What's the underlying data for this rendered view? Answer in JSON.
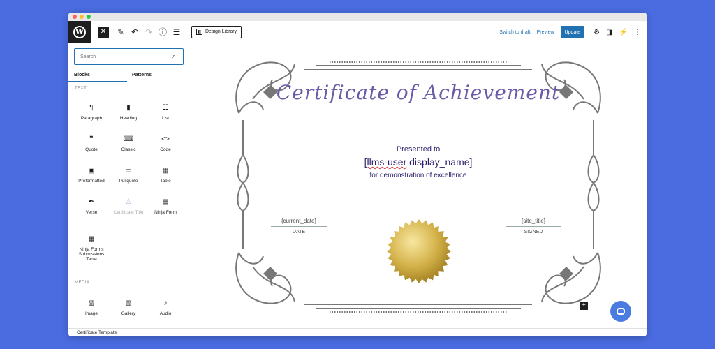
{
  "toolbar": {
    "close_glyph": "✕",
    "design_library_label": "Design Library",
    "switch_to_draft_label": "Switch to draft",
    "preview_label": "Preview",
    "update_label": "Update"
  },
  "sidebar": {
    "search_placeholder": "Search",
    "tabs": [
      {
        "label": "Blocks"
      },
      {
        "label": "Patterns"
      }
    ],
    "sections": {
      "text": {
        "label": "TEXT",
        "items": [
          {
            "label": "Paragraph",
            "icon": "paragraph-icon"
          },
          {
            "label": "Heading",
            "icon": "heading-icon"
          },
          {
            "label": "List",
            "icon": "list-icon"
          },
          {
            "label": "Quote",
            "icon": "quote-icon"
          },
          {
            "label": "Classic",
            "icon": "keyboard-icon"
          },
          {
            "label": "Code",
            "icon": "code-icon"
          },
          {
            "label": "Preformatted",
            "icon": "preformatted-icon"
          },
          {
            "label": "Pullquote",
            "icon": "pullquote-icon"
          },
          {
            "label": "Table",
            "icon": "table-icon"
          },
          {
            "label": "Verse",
            "icon": "verse-icon"
          },
          {
            "label": "Certificate Title",
            "icon": "certificate-icon"
          },
          {
            "label": "Ninja Form",
            "icon": "form-icon"
          },
          {
            "label": "Ninja Forms Submissions Table",
            "icon": "submissions-table-icon"
          }
        ]
      },
      "media": {
        "label": "MEDIA",
        "items": [
          {
            "label": "Image",
            "icon": "image-icon"
          },
          {
            "label": "Gallery",
            "icon": "gallery-icon"
          },
          {
            "label": "Audio",
            "icon": "audio-icon"
          }
        ]
      }
    }
  },
  "certificate": {
    "title": "Certificate of Achievement",
    "presented_to": "Presented to",
    "user_name_prefix": "[llms-user",
    "user_name_suffix": " display_name]",
    "excellence": "for demonstration of excellence",
    "date_value": "{current_date}",
    "date_label": "DATE",
    "signed_value": "{site_title}",
    "signed_label": "SIGNED"
  },
  "status_bar": {
    "breadcrumb": "Certificate Template"
  },
  "colors": {
    "background": "#4a6ce0",
    "accent": "#2271b1",
    "title": "#6a5aa7",
    "text": "#2b1f6b"
  }
}
